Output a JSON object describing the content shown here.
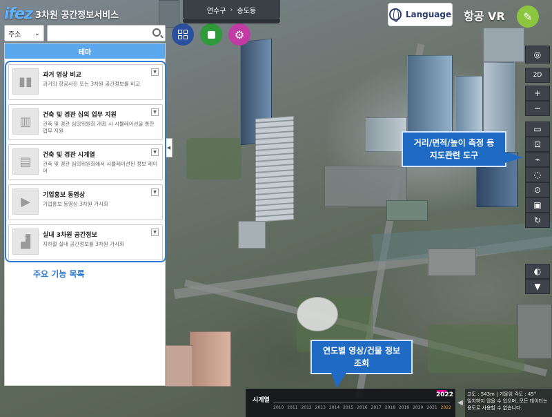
{
  "header": {
    "logo_mark": "ifez",
    "logo_title": "3차원 공간정보서비스",
    "breadcrumb": [
      "연수구",
      "송도동"
    ],
    "language_label": "Language",
    "vr_label": "항공 VR"
  },
  "search": {
    "select_value": "주소",
    "input_placeholder": ""
  },
  "panel": {
    "header": "테마",
    "cards": [
      {
        "title": "과거 영상 비교",
        "desc": "과거의 항공사진 또는 3차원 공간정보를 비교",
        "icon": "panels-icon"
      },
      {
        "title": "건축 및 경관 심의 업무 지원",
        "desc": "건축 및 경관 심의위원회 개최 시 시뮬레이션을 통한 업무 지원",
        "icon": "buildings-icon"
      },
      {
        "title": "건축 및 경관 시계열",
        "desc": "건축 및 경관 심의위원회에서 시뮬레이션된 정보 레이어",
        "icon": "city-icon"
      },
      {
        "title": "기업홍보 동영상",
        "desc": "기업홍보 동영상 3차원 가시화",
        "icon": "play-icon"
      },
      {
        "title": "실내 3차원 공간정보",
        "desc": "지하철 실내 공간정보를 3차원 가시화",
        "icon": "train-icon"
      }
    ]
  },
  "annotations": {
    "main_features": "주요 기능 목록",
    "measure_tools": "거리/면적/높이 측정 등\n지도관련 도구",
    "yearly_imagery": "연도별 영상/건물 정보\n조회"
  },
  "toolbar": {
    "mode_label": "2D",
    "zoom_in": "+",
    "zoom_out": "−"
  },
  "timeline": {
    "label": "시계열",
    "current_year": "2022",
    "years": [
      "2010",
      "2011",
      "2012",
      "2013",
      "2014",
      "2015",
      "2016",
      "2017",
      "2018",
      "2019",
      "2020",
      "2021",
      "2022"
    ],
    "selected_year": "2022"
  },
  "status": {
    "altitude": "고도 : 543m",
    "tilt": "기울임 각도 : 45°",
    "notice": "일치하지 않을 수 있으며, 모든 데이터는 용도로 사용할 수 없습니다."
  },
  "colors": {
    "panel_header": "#5ba8ef",
    "callout": "#1f6bc4",
    "frame": "#2d7bd4",
    "year_marker": "#d3008c"
  }
}
